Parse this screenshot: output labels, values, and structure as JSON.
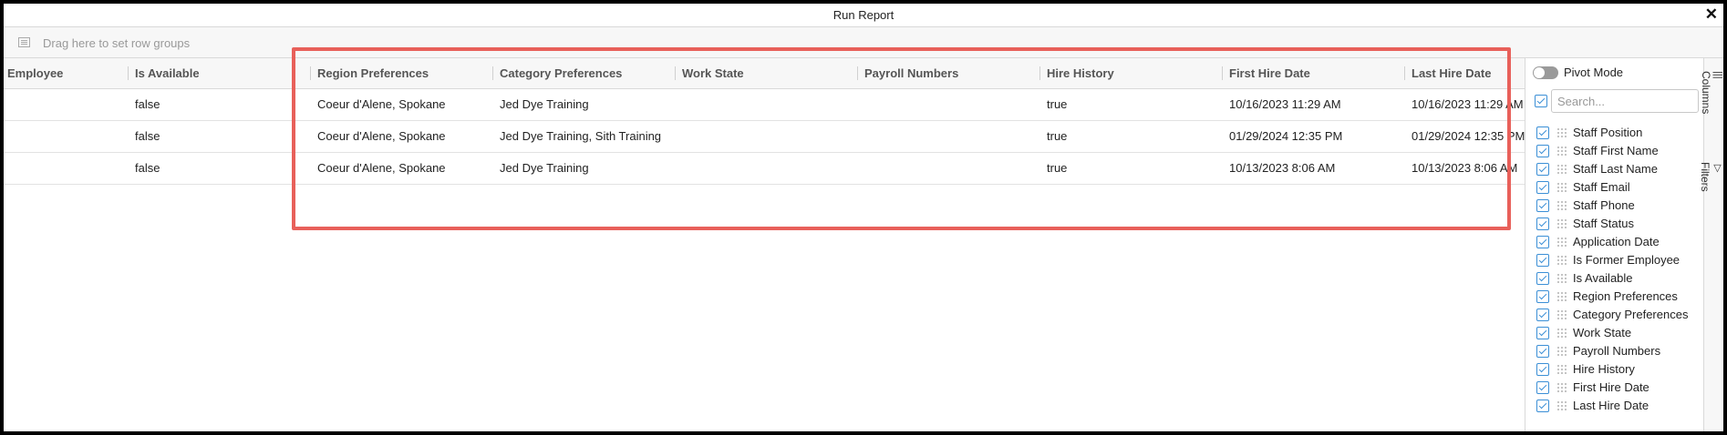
{
  "window": {
    "title": "Run Report"
  },
  "group_bar": {
    "placeholder": "Drag here to set row groups"
  },
  "grid": {
    "columns": [
      "Employee",
      "Is Available",
      "Region Preferences",
      "Category Preferences",
      "Work State",
      "Payroll Numbers",
      "Hire History",
      "First Hire Date",
      "Last Hire Date"
    ],
    "rows": [
      {
        "employee": "",
        "is_available": "false",
        "region_preferences": "Coeur d'Alene, Spokane",
        "category_preferences": "Jed Dye Training",
        "work_state": "",
        "payroll_numbers": "",
        "hire_history": "true",
        "first_hire_date": "10/16/2023 11:29 AM",
        "last_hire_date": "10/16/2023 11:29 AM"
      },
      {
        "employee": "",
        "is_available": "false",
        "region_preferences": "Coeur d'Alene, Spokane",
        "category_preferences": "Jed Dye Training, Sith Training",
        "work_state": "",
        "payroll_numbers": "",
        "hire_history": "true",
        "first_hire_date": "01/29/2024 12:35 PM",
        "last_hire_date": "01/29/2024 12:35 PM"
      },
      {
        "employee": "",
        "is_available": "false",
        "region_preferences": "Coeur d'Alene, Spokane",
        "category_preferences": "Jed Dye Training",
        "work_state": "",
        "payroll_numbers": "",
        "hire_history": "true",
        "first_hire_date": "10/13/2023 8:06 AM",
        "last_hire_date": "10/13/2023 8:06 AM"
      }
    ]
  },
  "tool_panel": {
    "pivot_mode_label": "Pivot Mode",
    "search_placeholder": "Search...",
    "columns": [
      "Staff Position",
      "Staff First Name",
      "Staff Last Name",
      "Staff Email",
      "Staff Phone",
      "Staff Status",
      "Application Date",
      "Is Former Employee",
      "Is Available",
      "Region Preferences",
      "Category Preferences",
      "Work State",
      "Payroll Numbers",
      "Hire History",
      "First Hire Date",
      "Last Hire Date"
    ]
  },
  "side_tabs": {
    "columns_label": "Columns",
    "filters_label": "Filters"
  },
  "colors": {
    "highlight": "#e8605a",
    "checkbox": "#3b8fd6"
  }
}
